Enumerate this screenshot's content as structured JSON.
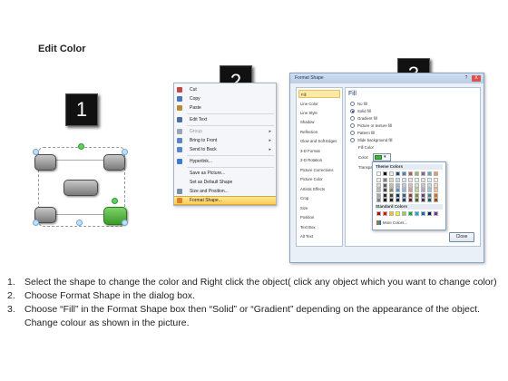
{
  "title": "Edit Color",
  "steps": {
    "one": "1",
    "two": "2",
    "three": "3"
  },
  "diagram": {
    "center_color": "#8a8a8a",
    "selected_color": "#3cb63c"
  },
  "context_menu": {
    "items": [
      {
        "label": "Cut",
        "icon": "scissors-icon",
        "icon_color": "#c04a4a"
      },
      {
        "label": "Copy",
        "icon": "copy-icon",
        "icon_color": "#4a77b5"
      },
      {
        "label": "Paste",
        "icon": "paste-icon",
        "icon_color": "#b98a3a"
      },
      {
        "label": "Edit Text",
        "icon": "edit-text-icon",
        "icon_color": "#4a6fa5"
      },
      {
        "label": "Group",
        "icon": "group-icon",
        "icon_color": "#9aa7b5",
        "disabled": true,
        "arrow": "▸"
      },
      {
        "label": "Bring to Front",
        "icon": "bring-front-icon",
        "icon_color": "#5a86c5",
        "arrow": "▸"
      },
      {
        "label": "Send to Back",
        "icon": "send-back-icon",
        "icon_color": "#5a86c5",
        "arrow": "▸"
      },
      {
        "label": "Hyperlink...",
        "icon": "hyperlink-icon",
        "icon_color": "#3a7bd5"
      },
      {
        "label": "Save as Picture...",
        "icon": "",
        "icon_color": ""
      },
      {
        "label": "Set as Default Shape",
        "icon": "",
        "icon_color": ""
      },
      {
        "label": "Size and Position...",
        "icon": "size-position-icon",
        "icon_color": "#7a8fa8"
      },
      {
        "label": "Format Shape...",
        "icon": "format-shape-icon",
        "icon_color": "#d9822b"
      }
    ]
  },
  "dialog": {
    "title": "Format Shape",
    "help": "?",
    "close_x": "X",
    "sidebar": [
      "Fill",
      "Line Color",
      "Line Style",
      "Shadow",
      "Reflection",
      "Glow and Soft Edges",
      "3-D Format",
      "3-D Rotation",
      "Picture Corrections",
      "Picture Color",
      "Artistic Effects",
      "Crop",
      "Size",
      "Position",
      "Text Box",
      "Alt Text"
    ],
    "selected_sidebar": "Fill",
    "heading": "Fill",
    "options": [
      "No fill",
      "Solid fill",
      "Gradient fill",
      "Picture or texture fill",
      "Pattern fill",
      "Slide background fill"
    ],
    "selected_option": "Solid fill",
    "fill_color_label": "Fill Color",
    "color_label": "Color:",
    "transparency_label": "Transpa",
    "close_button": "Close"
  },
  "palette": {
    "theme_label": "Theme Colors",
    "standard_label": "Standard Colors",
    "more_label": "More Colors...",
    "theme_top": [
      "#ffffff",
      "#000000",
      "#eeece1",
      "#1f497d",
      "#4f81bd",
      "#c0504d",
      "#9bbb59",
      "#8064a2",
      "#4bacc6",
      "#f79646"
    ],
    "theme_cols": [
      [
        "#f2f2f2",
        "#d9d9d9",
        "#bfbfbf",
        "#a6a6a6",
        "#808080"
      ],
      [
        "#7f7f7f",
        "#595959",
        "#404040",
        "#262626",
        "#0d0d0d"
      ],
      [
        "#ddd9c3",
        "#c4bd97",
        "#948a54",
        "#4a452a",
        "#1e1c11"
      ],
      [
        "#c6d9f0",
        "#8db3e2",
        "#548dd4",
        "#17365d",
        "#0f243e"
      ],
      [
        "#dbe5f1",
        "#b8cce4",
        "#95b3d7",
        "#366092",
        "#244061"
      ],
      [
        "#f2dcdb",
        "#e5b9b7",
        "#d99694",
        "#953734",
        "#632423"
      ],
      [
        "#ebf1dd",
        "#d7e3bc",
        "#c3d69b",
        "#76923c",
        "#4f6128"
      ],
      [
        "#e5e0ec",
        "#ccc1d9",
        "#b2a2c7",
        "#5f497a",
        "#3f3151"
      ],
      [
        "#dbeef3",
        "#b7dde8",
        "#92cddc",
        "#31859b",
        "#205867"
      ],
      [
        "#fdeada",
        "#fbd5b5",
        "#fac08f",
        "#e36c09",
        "#974806"
      ]
    ],
    "standard": [
      "#c00000",
      "#ff0000",
      "#ffc000",
      "#ffff00",
      "#92d050",
      "#00b050",
      "#00b0f0",
      "#0070c0",
      "#002060",
      "#7030a0"
    ]
  },
  "instructions": [
    {
      "num": "1.",
      "text": "Select the shape to change the color and Right click the object( click any object which you want to change color)"
    },
    {
      "num": "2.",
      "text": "Choose Format Shape in the dialog box."
    },
    {
      "num": "3.",
      "text": "Choose “Fill” in the Format Shape box then “Solid” or “Gradient” depending on the appearance of the object. Change colour as shown in the picture."
    }
  ]
}
